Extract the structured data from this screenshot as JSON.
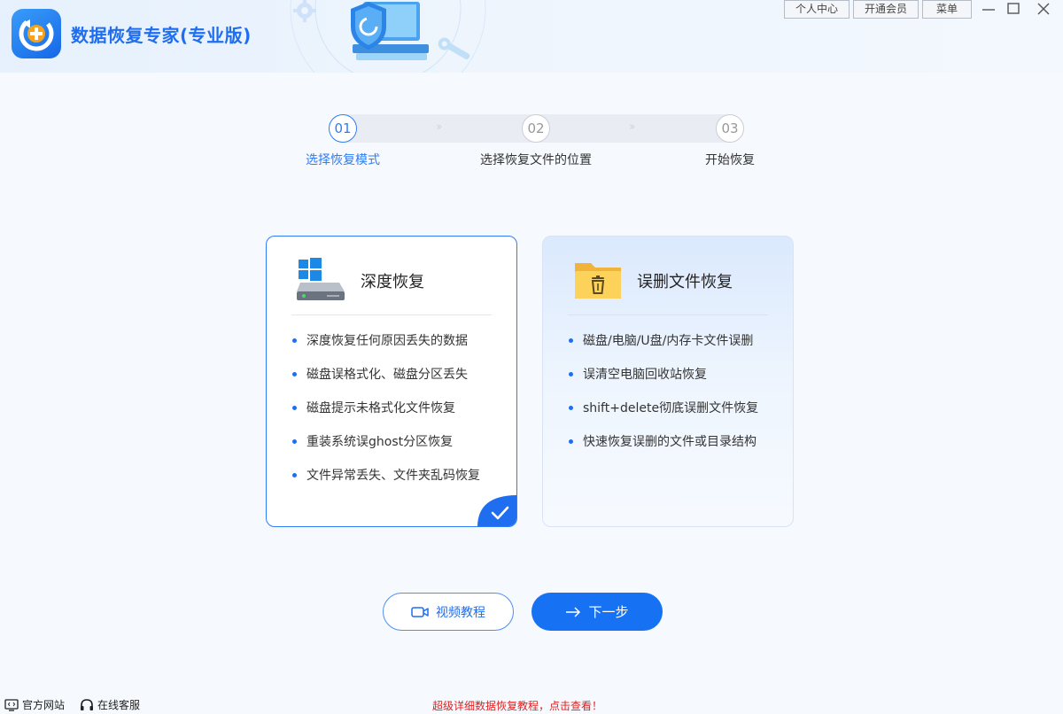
{
  "app": {
    "title": "数据恢复专家(专业版)",
    "logo_icon": "app-recovery-icon"
  },
  "header": {
    "buttons": {
      "personal": "个人中心",
      "member": "开通会员",
      "menu": "菜单"
    },
    "window_controls": [
      "minimize-icon",
      "maximize-icon",
      "close-icon"
    ]
  },
  "steps": [
    {
      "number": "01",
      "label": "选择恢复模式",
      "active": true
    },
    {
      "number": "02",
      "label": "选择恢复文件的位置",
      "active": false
    },
    {
      "number": "03",
      "label": "开始恢复",
      "active": false
    }
  ],
  "step_separator": "››",
  "cards": {
    "deep": {
      "title": "深度恢复",
      "icon": "disk-windows-icon",
      "selected": true,
      "features": [
        "深度恢复任何原因丢失的数据",
        "磁盘误格式化、磁盘分区丢失",
        "磁盘提示未格式化文件恢复",
        "重装系统误ghost分区恢复",
        "文件异常丢失、文件夹乱码恢复"
      ]
    },
    "deleted": {
      "title": "误删文件恢复",
      "icon": "folder-trash-icon",
      "selected": false,
      "features": [
        "磁盘/电脑/U盘/内存卡文件误删",
        "误清空电脑回收站恢复",
        "shift+delete彻底误删文件恢复",
        "快速恢复误删的文件或目录结构"
      ]
    }
  },
  "actions": {
    "video_tutorial": "视频教程",
    "next": "下一步"
  },
  "footer": {
    "official_site": "官方网站",
    "online_service": "在线客服",
    "promo": "超级详细数据恢复教程，点击查看！"
  },
  "colors": {
    "accent": "#1f6ef0",
    "primary_button": "#1672f2",
    "promo_text": "#e02020"
  }
}
